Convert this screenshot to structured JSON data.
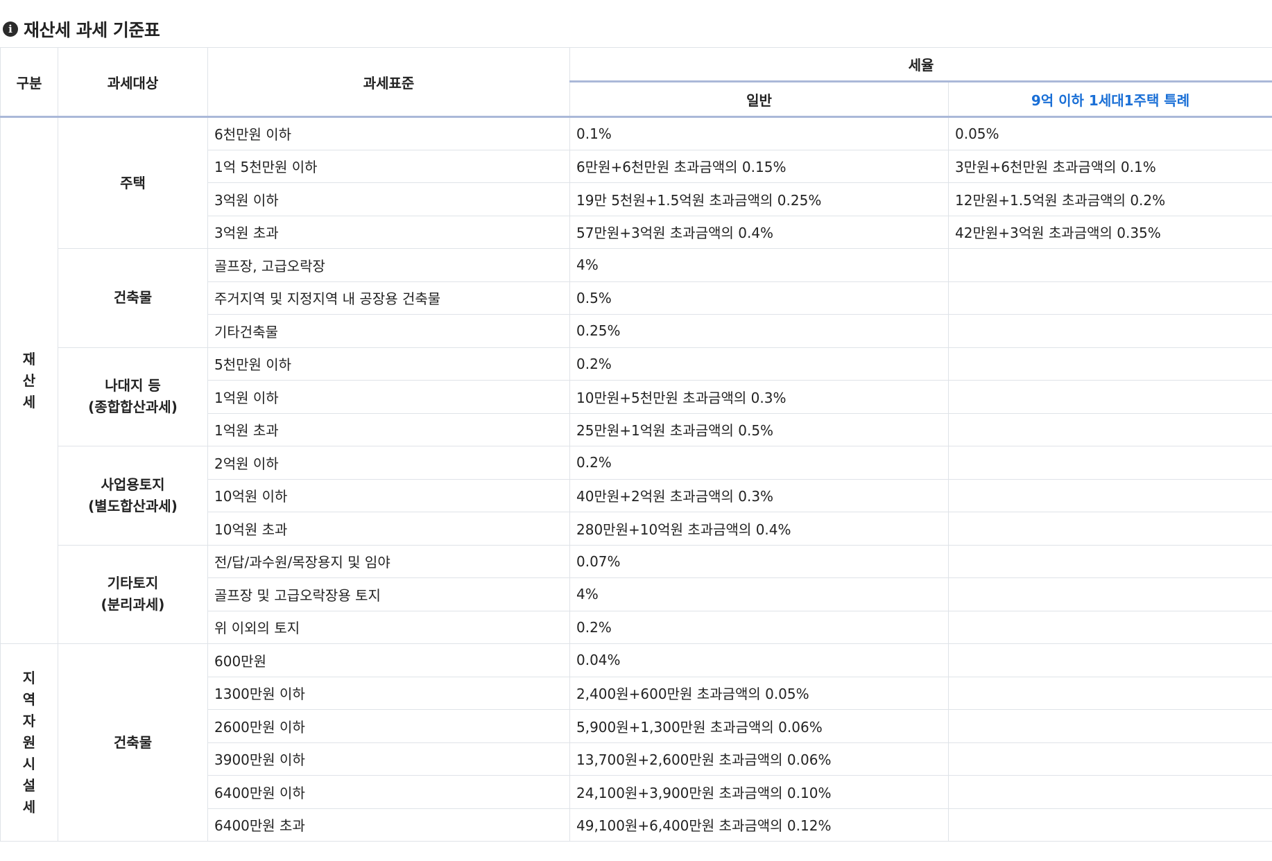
{
  "page": {
    "title": "재산세 과세 기준표",
    "icon": "info-icon"
  },
  "colors": {
    "accent": "#1a6fd6",
    "header_rule": "#aab8d8",
    "border": "#dfe3e8"
  },
  "header": {
    "category": "구분",
    "target": "과세대상",
    "standard": "과세표준",
    "rate": "세율",
    "general": "일반",
    "special": "9억 이하 1세대1주택 특례"
  },
  "sections": [
    {
      "category": "재산세",
      "groups": [
        {
          "label": [
            "주택"
          ],
          "rows": [
            [
              "6천만원 이하",
              "0.1%",
              "0.05%"
            ],
            [
              "1억 5천만원 이하",
              "6만원+6천만원 초과금액의 0.15%",
              "3만원+6천만원 초과금액의 0.1%"
            ],
            [
              "3억원 이하",
              "19만 5천원+1.5억원 초과금액의 0.25%",
              "12만원+1.5억원 초과금액의 0.2%"
            ],
            [
              "3억원 초과",
              "57만원+3억원 초과금액의 0.4%",
              "42만원+3억원 초과금액의 0.35%"
            ]
          ]
        },
        {
          "label": [
            "건축물"
          ],
          "rows": [
            [
              "골프장, 고급오락장",
              "4%",
              ""
            ],
            [
              "주거지역 및 지정지역 내 공장용 건축물",
              "0.5%",
              ""
            ],
            [
              "기타건축물",
              "0.25%",
              ""
            ]
          ]
        },
        {
          "label": [
            "나대지 등",
            "(종합합산과세)"
          ],
          "rows": [
            [
              "5천만원 이하",
              "0.2%",
              ""
            ],
            [
              "1억원 이하",
              "10만원+5천만원 초과금액의 0.3%",
              ""
            ],
            [
              "1억원 초과",
              "25만원+1억원 초과금액의 0.5%",
              ""
            ]
          ]
        },
        {
          "label": [
            "사업용토지",
            "(별도합산과세)"
          ],
          "rows": [
            [
              "2억원 이하",
              "0.2%",
              ""
            ],
            [
              "10억원 이하",
              "40만원+2억원 초과금액의 0.3%",
              ""
            ],
            [
              "10억원 초과",
              "280만원+10억원 초과금액의 0.4%",
              ""
            ]
          ]
        },
        {
          "label": [
            "기타토지",
            "(분리과세)"
          ],
          "rows": [
            [
              "전/답/과수원/목장용지 및 임야",
              "0.07%",
              ""
            ],
            [
              "골프장 및 고급오락장용 토지",
              "4%",
              ""
            ],
            [
              "위 이외의 토지",
              "0.2%",
              ""
            ]
          ]
        }
      ]
    },
    {
      "category": "지역자원시설세",
      "groups": [
        {
          "label": [
            "건축물"
          ],
          "rows": [
            [
              "600만원",
              "0.04%",
              ""
            ],
            [
              "1300만원 이하",
              "2,400원+600만원 초과금액의 0.05%",
              ""
            ],
            [
              "2600만원 이하",
              "5,900원+1,300만원 초과금액의 0.06%",
              ""
            ],
            [
              "3900만원 이하",
              "13,700원+2,600만원 초과금액의 0.06%",
              ""
            ],
            [
              "6400만원 이하",
              "24,100원+3,900만원 초과금액의 0.10%",
              ""
            ],
            [
              "6400만원 초과",
              "49,100원+6,400만원 초과금액의 0.12%",
              ""
            ]
          ]
        }
      ]
    }
  ]
}
